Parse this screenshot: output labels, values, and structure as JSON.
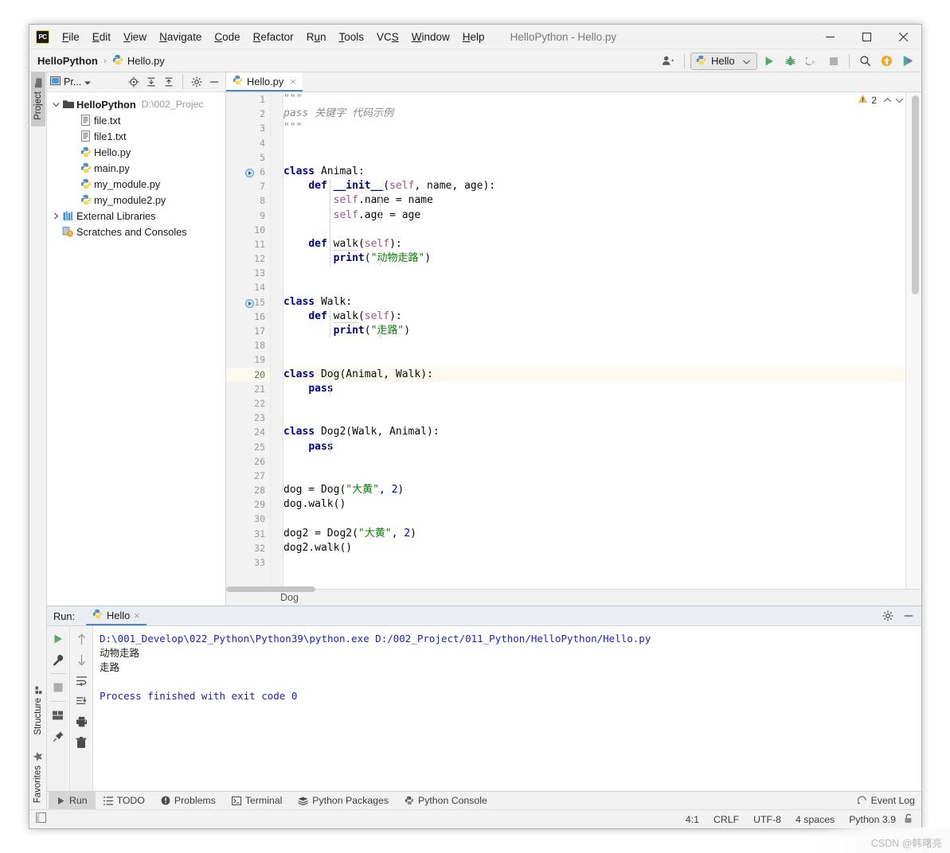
{
  "window": {
    "title": "HelloPython - Hello.py",
    "logo": "pycharm-logo",
    "minimize": "–",
    "maximize": "□",
    "close": "✕"
  },
  "menu": [
    {
      "label": "File",
      "mnemonic": "F"
    },
    {
      "label": "Edit",
      "mnemonic": "E"
    },
    {
      "label": "View",
      "mnemonic": "V"
    },
    {
      "label": "Navigate",
      "mnemonic": "N"
    },
    {
      "label": "Code",
      "mnemonic": "C"
    },
    {
      "label": "Refactor",
      "mnemonic": "R"
    },
    {
      "label": "Run",
      "mnemonic": "u"
    },
    {
      "label": "Tools",
      "mnemonic": "T"
    },
    {
      "label": "VCS",
      "mnemonic": "S"
    },
    {
      "label": "Window",
      "mnemonic": "W"
    },
    {
      "label": "Help",
      "mnemonic": "H"
    }
  ],
  "navbar": {
    "project": "HelloPython",
    "separator": "›",
    "file": "Hello.py",
    "run_config": "Hello",
    "run_config_chevron": "⌵"
  },
  "rail": {
    "project_tab": "Project",
    "structure_tab": "Structure",
    "favorites_tab": "Favorites"
  },
  "project_panel": {
    "title": "Pr...",
    "tree": [
      {
        "label": "HelloPython",
        "path": "D:\\002_Projec",
        "icon": "folder-icon",
        "depth": 0,
        "twist": "⌄",
        "bold": true
      },
      {
        "label": "file.txt",
        "path": "",
        "icon": "text-file-icon",
        "depth": 1,
        "twist": "",
        "bold": false
      },
      {
        "label": "file1.txt",
        "path": "",
        "icon": "text-file-icon",
        "depth": 1,
        "twist": "",
        "bold": false
      },
      {
        "label": "Hello.py",
        "path": "",
        "icon": "python-file-icon",
        "depth": 1,
        "twist": "",
        "bold": false
      },
      {
        "label": "main.py",
        "path": "",
        "icon": "python-file-icon",
        "depth": 1,
        "twist": "",
        "bold": false
      },
      {
        "label": "my_module.py",
        "path": "",
        "icon": "python-file-icon",
        "depth": 1,
        "twist": "",
        "bold": false
      },
      {
        "label": "my_module2.py",
        "path": "",
        "icon": "python-file-icon",
        "depth": 1,
        "twist": "",
        "bold": false
      },
      {
        "label": "External Libraries",
        "path": "",
        "icon": "libraries-icon",
        "depth": 0,
        "twist": "›",
        "bold": false
      },
      {
        "label": "Scratches and Consoles",
        "path": "",
        "icon": "scratches-icon",
        "depth": 0,
        "twist": "",
        "bold": false
      }
    ]
  },
  "editor": {
    "tab": "Hello.py",
    "tab_close": "×",
    "warning_count": "2",
    "warning_up": "⌃",
    "warning_down": "⌄",
    "breadcrumb": "Dog",
    "first_line": 1,
    "last_line": 33,
    "current_line": 20,
    "lines": [
      {
        "n": 1,
        "tokens": [
          {
            "t": "\"\"\"",
            "c": "dstr"
          }
        ],
        "fold": "open",
        "gutterRun": false
      },
      {
        "n": 2,
        "tokens": [
          {
            "t": "pass 关键字 代码示例",
            "c": "dstr"
          }
        ],
        "fold": "",
        "gutterRun": false
      },
      {
        "n": 3,
        "tokens": [
          {
            "t": "\"\"\"",
            "c": "dstr"
          }
        ],
        "fold": "close",
        "gutterRun": false
      },
      {
        "n": 4,
        "tokens": [],
        "fold": "",
        "gutterRun": false
      },
      {
        "n": 5,
        "tokens": [],
        "fold": "",
        "gutterRun": false
      },
      {
        "n": 6,
        "tokens": [
          {
            "t": "class ",
            "c": "kw"
          },
          {
            "t": "Animal:",
            "c": ""
          }
        ],
        "fold": "open",
        "gutterRun": true
      },
      {
        "n": 7,
        "tokens": [
          {
            "t": "    ",
            "c": ""
          },
          {
            "t": "def ",
            "c": "kw"
          },
          {
            "t": "__init__",
            "c": "fnname"
          },
          {
            "t": "(",
            "c": ""
          },
          {
            "t": "self",
            "c": "self"
          },
          {
            "t": ", name, age):",
            "c": ""
          }
        ],
        "fold": "open",
        "gutterRun": false
      },
      {
        "n": 8,
        "tokens": [
          {
            "t": "        ",
            "c": ""
          },
          {
            "t": "self",
            "c": "self"
          },
          {
            "t": ".name = name",
            "c": ""
          }
        ],
        "fold": "",
        "gutterRun": false
      },
      {
        "n": 9,
        "tokens": [
          {
            "t": "        ",
            "c": ""
          },
          {
            "t": "self",
            "c": "self"
          },
          {
            "t": ".age = age",
            "c": ""
          }
        ],
        "fold": "close",
        "gutterRun": false
      },
      {
        "n": 10,
        "tokens": [],
        "fold": "",
        "gutterRun": false
      },
      {
        "n": 11,
        "tokens": [
          {
            "t": "    ",
            "c": ""
          },
          {
            "t": "def ",
            "c": "kw"
          },
          {
            "t": "walk",
            "c": "wavy"
          },
          {
            "t": "(",
            "c": ""
          },
          {
            "t": "self",
            "c": "self"
          },
          {
            "t": "):",
            "c": ""
          }
        ],
        "fold": "open",
        "gutterRun": false
      },
      {
        "n": 12,
        "tokens": [
          {
            "t": "        ",
            "c": ""
          },
          {
            "t": "print",
            "c": "fn"
          },
          {
            "t": "(",
            "c": ""
          },
          {
            "t": "\"动物走路\"",
            "c": "str"
          },
          {
            "t": ")",
            "c": ""
          }
        ],
        "fold": "close",
        "gutterRun": false
      },
      {
        "n": 13,
        "tokens": [],
        "fold": "",
        "gutterRun": false
      },
      {
        "n": 14,
        "tokens": [],
        "fold": "",
        "gutterRun": false
      },
      {
        "n": 15,
        "tokens": [
          {
            "t": "class ",
            "c": "kw"
          },
          {
            "t": "Walk:",
            "c": ""
          }
        ],
        "fold": "open",
        "gutterRun": true
      },
      {
        "n": 16,
        "tokens": [
          {
            "t": "    ",
            "c": ""
          },
          {
            "t": "def ",
            "c": "kw"
          },
          {
            "t": "walk",
            "c": "wavy"
          },
          {
            "t": "(",
            "c": ""
          },
          {
            "t": "self",
            "c": "self"
          },
          {
            "t": "):",
            "c": ""
          }
        ],
        "fold": "open",
        "gutterRun": false
      },
      {
        "n": 17,
        "tokens": [
          {
            "t": "        ",
            "c": ""
          },
          {
            "t": "print",
            "c": "fn"
          },
          {
            "t": "(",
            "c": ""
          },
          {
            "t": "\"走路\"",
            "c": "str"
          },
          {
            "t": ")",
            "c": ""
          }
        ],
        "fold": "close",
        "gutterRun": false
      },
      {
        "n": 18,
        "tokens": [],
        "fold": "",
        "gutterRun": false
      },
      {
        "n": 19,
        "tokens": [],
        "fold": "",
        "gutterRun": false
      },
      {
        "n": 20,
        "tokens": [
          {
            "t": "class ",
            "c": "kw"
          },
          {
            "t": "Dog(Animal, Walk):",
            "c": ""
          }
        ],
        "fold": "open",
        "gutterRun": false
      },
      {
        "n": 21,
        "tokens": [
          {
            "t": "    ",
            "c": ""
          },
          {
            "t": "pass",
            "c": "kw"
          }
        ],
        "fold": "close",
        "gutterRun": false
      },
      {
        "n": 22,
        "tokens": [],
        "fold": "",
        "gutterRun": false
      },
      {
        "n": 23,
        "tokens": [],
        "fold": "",
        "gutterRun": false
      },
      {
        "n": 24,
        "tokens": [
          {
            "t": "class ",
            "c": "kw"
          },
          {
            "t": "Dog2(Walk, Animal):",
            "c": ""
          }
        ],
        "fold": "open",
        "gutterRun": false
      },
      {
        "n": 25,
        "tokens": [
          {
            "t": "    ",
            "c": ""
          },
          {
            "t": "pass",
            "c": "kw"
          }
        ],
        "fold": "close",
        "gutterRun": false
      },
      {
        "n": 26,
        "tokens": [],
        "fold": "",
        "gutterRun": false
      },
      {
        "n": 27,
        "tokens": [],
        "fold": "",
        "gutterRun": false
      },
      {
        "n": 28,
        "tokens": [
          {
            "t": "dog = Dog(",
            "c": ""
          },
          {
            "t": "\"大黄\"",
            "c": "str"
          },
          {
            "t": ", ",
            "c": ""
          },
          {
            "t": "2",
            "c": "num"
          },
          {
            "t": ")",
            "c": ""
          }
        ],
        "fold": "",
        "gutterRun": false
      },
      {
        "n": 29,
        "tokens": [
          {
            "t": "dog.walk()",
            "c": ""
          }
        ],
        "fold": "",
        "gutterRun": false
      },
      {
        "n": 30,
        "tokens": [],
        "fold": "",
        "gutterRun": false
      },
      {
        "n": 31,
        "tokens": [
          {
            "t": "dog2 = Dog2(",
            "c": ""
          },
          {
            "t": "\"大黄\"",
            "c": "str"
          },
          {
            "t": ", ",
            "c": ""
          },
          {
            "t": "2",
            "c": "num"
          },
          {
            "t": ")",
            "c": ""
          }
        ],
        "fold": "",
        "gutterRun": false
      },
      {
        "n": 32,
        "tokens": [
          {
            "t": "dog2.walk()",
            "c": ""
          }
        ],
        "fold": "",
        "gutterRun": false
      },
      {
        "n": 33,
        "tokens": [],
        "fold": "",
        "gutterRun": false
      }
    ]
  },
  "run_window": {
    "label": "Run:",
    "tab": "Hello",
    "tab_close": "×",
    "console": [
      {
        "text": "D:\\001_Develop\\022_Python\\Python39\\python.exe D:/002_Project/011_Python/HelloPython/Hello.py",
        "style": "cmd"
      },
      {
        "text": "动物走路",
        "style": "out"
      },
      {
        "text": "走路",
        "style": "out"
      },
      {
        "text": "",
        "style": "out"
      },
      {
        "text": "Process finished with exit code 0",
        "style": "done"
      }
    ]
  },
  "toolstrip": [
    {
      "label": "Run",
      "icon": "play-icon",
      "active": true
    },
    {
      "label": "TODO",
      "icon": "todo-list-icon",
      "active": false
    },
    {
      "label": "Problems",
      "icon": "problems-icon",
      "active": false
    },
    {
      "label": "Terminal",
      "icon": "terminal-icon",
      "active": false
    },
    {
      "label": "Python Packages",
      "icon": "packages-icon",
      "active": false
    },
    {
      "label": "Python Console",
      "icon": "python-console-icon",
      "active": false
    }
  ],
  "event_log": "Event Log",
  "statusbar": {
    "caret": "4:1",
    "line_sep": "CRLF",
    "encoding": "UTF-8",
    "indent": "4 spaces",
    "interpreter": "Python 3.9",
    "lock": "lock-icon"
  },
  "watermark": "CSDN @韩曙亮",
  "colors": {
    "accent": "#4a86c8",
    "keyword": "#00008b",
    "string": "#008000",
    "self": "#94558d",
    "number": "#0000c8",
    "docstring": "#8c8c8c",
    "highlight_line": "#fcfaed",
    "chrome": "#f2f2f2"
  }
}
